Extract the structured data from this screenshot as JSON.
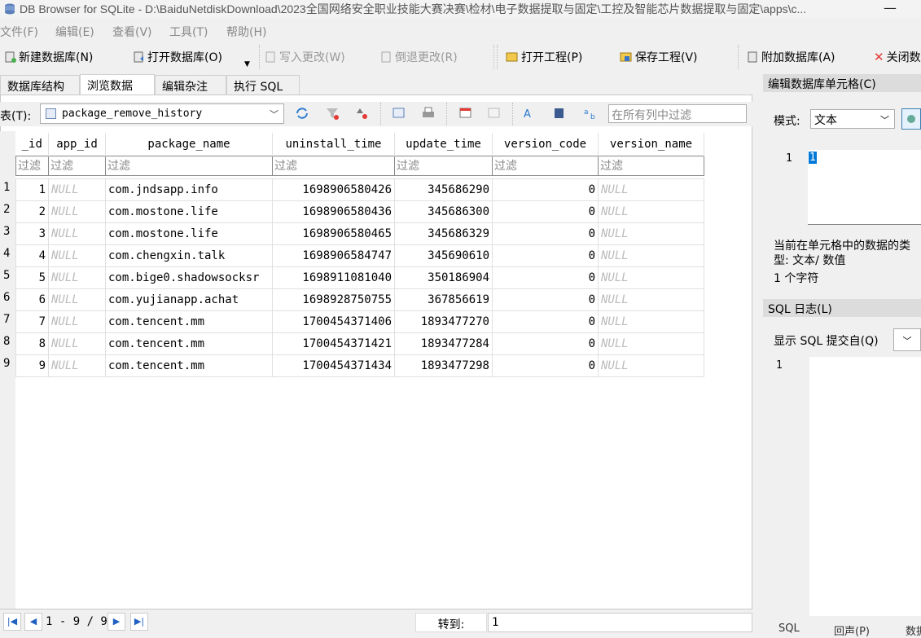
{
  "window": {
    "title": "DB Browser for SQLite - D:\\BaiduNetdiskDownload\\2023全国网络安全职业技能大赛决赛\\检材\\电子数据提取与固定\\工控及智能芯片数据提取与固定\\apps\\c...",
    "minimize_label": "—"
  },
  "menu": [
    "文件(F)",
    "编辑(E)",
    "查看(V)",
    "工具(T)",
    "帮助(H)"
  ],
  "toolbar": {
    "new_db": "新建数据库(N)",
    "open_db": "打开数据库(O)",
    "write_changes": "写入更改(W)",
    "revert_changes": "倒退更改(R)",
    "open_project": "打开工程(P)",
    "save_project": "保存工程(V)",
    "attach_db": "附加数据库(A)",
    "close_db": "关闭数"
  },
  "tabs": [
    "数据库结构",
    "浏览数据",
    "编辑杂注",
    "执行 SQL"
  ],
  "browse": {
    "table_label": "表(T):",
    "table_name": "package_remove_history",
    "filter_all_placeholder": "在所有列中过滤",
    "filter_placeholder": "过滤",
    "columns": [
      "_id",
      "app_id",
      "package_name",
      "uninstall_time",
      "update_time",
      "version_code",
      "version_name"
    ],
    "rows": [
      [
        "1",
        "NULL",
        "com.jndsapp.info",
        "1698906580426",
        "345686290",
        "0",
        "NULL"
      ],
      [
        "2",
        "NULL",
        "com.mostone.life",
        "1698906580436",
        "345686300",
        "0",
        "NULL"
      ],
      [
        "3",
        "NULL",
        "com.mostone.life",
        "1698906580465",
        "345686329",
        "0",
        "NULL"
      ],
      [
        "4",
        "NULL",
        "com.chengxin.talk",
        "1698906584747",
        "345690610",
        "0",
        "NULL"
      ],
      [
        "5",
        "NULL",
        "com.bige0.shadowsocksr",
        "1698911081040",
        "350186904",
        "0",
        "NULL"
      ],
      [
        "6",
        "NULL",
        "com.yujianapp.achat",
        "1698928750755",
        "367856619",
        "0",
        "NULL"
      ],
      [
        "7",
        "NULL",
        "com.tencent.mm",
        "1700454371406",
        "1893477270",
        "0",
        "NULL"
      ],
      [
        "8",
        "NULL",
        "com.tencent.mm",
        "1700454371421",
        "1893477284",
        "0",
        "NULL"
      ],
      [
        "9",
        "NULL",
        "com.tencent.mm",
        "1700454371434",
        "1893477298",
        "0",
        "NULL"
      ]
    ],
    "row_numbers": [
      "1",
      "2",
      "3",
      "4",
      "5",
      "6",
      "7",
      "8",
      "9"
    ],
    "pager": {
      "range_text": "1 - 9 / 9",
      "goto_label": "转到:",
      "goto_value": "1"
    }
  },
  "edit_cell": {
    "header": "编辑数据库单元格(C)",
    "mode_label": "模式:",
    "mode_value": "文本",
    "line_number": "1",
    "cell_value": "1",
    "type_info": "当前在单元格中的数据的类型: 文本/ 数值",
    "char_count": "1 个字符"
  },
  "sql_log": {
    "header": "SQL 日志(L)",
    "show_label": "显示 SQL 提交自(Q)",
    "line_number": "1",
    "bottom_tabs": [
      "SQL",
      "回声(P)",
      "数据"
    ]
  }
}
